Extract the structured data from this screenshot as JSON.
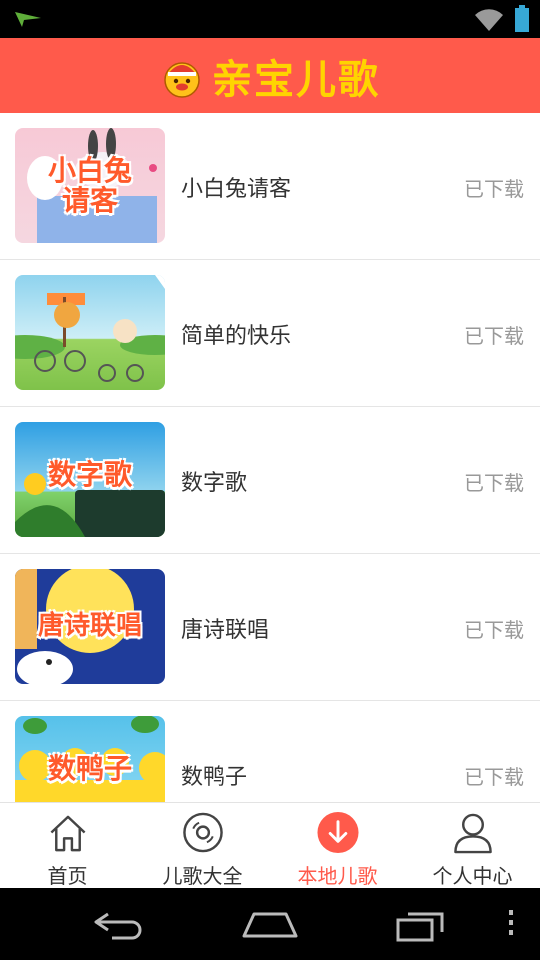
{
  "app": {
    "title": "亲宝儿歌"
  },
  "list": [
    {
      "name": "小白兔请客",
      "thumb_text": "小白兔请客",
      "status": "已下载"
    },
    {
      "name": "简单的快乐",
      "thumb_text": "",
      "status": "已下载"
    },
    {
      "name": "数字歌",
      "thumb_text": "数字歌",
      "status": "已下载"
    },
    {
      "name": "唐诗联唱",
      "thumb_text": "唐诗联唱",
      "status": "已下载"
    },
    {
      "name": "数鸭子",
      "thumb_text": "数鸭子",
      "status": "已下载"
    }
  ],
  "tabs": [
    {
      "label": "首页",
      "icon": "home-icon"
    },
    {
      "label": "儿歌大全",
      "icon": "disc-icon"
    },
    {
      "label": "本地儿歌",
      "icon": "download-icon",
      "active": true
    },
    {
      "label": "个人中心",
      "icon": "person-icon"
    }
  ],
  "colors": {
    "header": "#ff5a4b",
    "title": "#ffd400",
    "active_tab": "#ff5a4b"
  }
}
